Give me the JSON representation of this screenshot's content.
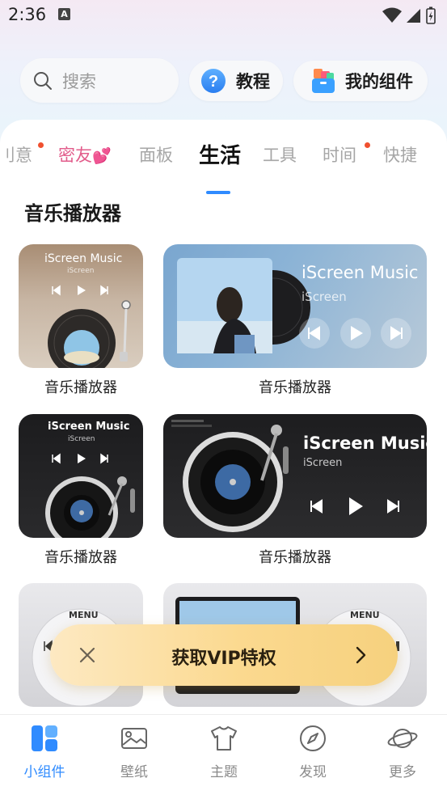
{
  "status_bar": {
    "time": "2:36",
    "notification_glyph": "A"
  },
  "search": {
    "placeholder": "搜索"
  },
  "top_buttons": {
    "tutorial": "教程",
    "my_widgets": "我的组件"
  },
  "tabs": [
    {
      "label": "创意",
      "visible_text": "刂意",
      "dot": true
    },
    {
      "label": "密友",
      "emoji": "💕",
      "dot": false,
      "pink": true
    },
    {
      "label": "面板",
      "dot": false
    },
    {
      "label": "生活",
      "dot": false,
      "active": true
    },
    {
      "label": "工具",
      "dot": false
    },
    {
      "label": "时间",
      "dot": true
    },
    {
      "label": "快捷",
      "dot": false
    }
  ],
  "section": {
    "title": "音乐播放器"
  },
  "widgets": [
    {
      "label": "音乐播放器",
      "title": "iScreen Music",
      "subtitle": "iScreen",
      "style": "small-warm"
    },
    {
      "label": "音乐播放器",
      "title": "iScreen Music",
      "subtitle": "iScreen",
      "style": "wide-blue"
    },
    {
      "label": "音乐播放器",
      "title": "iScreen Music",
      "subtitle": "iScreen",
      "style": "small-dark"
    },
    {
      "label": "音乐播放器",
      "title": "iScreen Music",
      "subtitle": "iScreen",
      "style": "wide-dark"
    },
    {
      "label": "",
      "menu_text": "MENU",
      "style": "small-ipod"
    },
    {
      "label": "",
      "menu_text": "MENU",
      "style": "wide-ipod"
    }
  ],
  "vip_banner": {
    "text": "获取VIP特权"
  },
  "bottom_nav": [
    {
      "label": "小组件",
      "icon": "widgets-icon",
      "active": true
    },
    {
      "label": "壁纸",
      "icon": "image-icon"
    },
    {
      "label": "主题",
      "icon": "shirt-icon"
    },
    {
      "label": "发现",
      "icon": "compass-icon"
    },
    {
      "label": "更多",
      "icon": "planet-icon"
    }
  ],
  "colors": {
    "accent": "#2f8bff",
    "tab_dot": "#f0502f",
    "pink_tab": "#e25c8b",
    "vip_gold": "#fbd98f"
  }
}
